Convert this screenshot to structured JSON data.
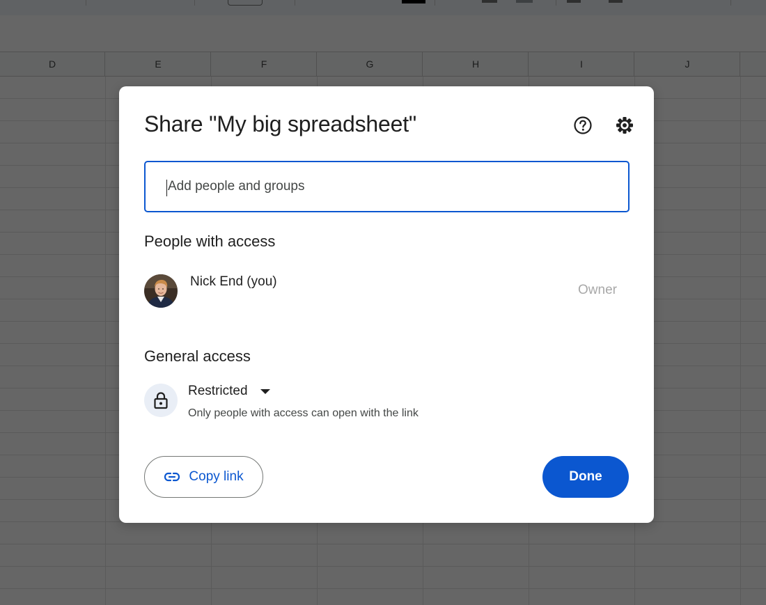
{
  "spreadsheet": {
    "column_headers": [
      "D",
      "E",
      "F",
      "G",
      "H",
      "I",
      "J"
    ]
  },
  "dialog": {
    "title": "Share \"My big spreadsheet\"",
    "help_icon": "help-circle-icon",
    "settings_icon": "gear-icon",
    "add_people": {
      "placeholder": "Add people and groups",
      "value": ""
    },
    "people_heading": "People with access",
    "people": [
      {
        "name": "Nick End (you)",
        "role": "Owner",
        "avatar": "user-avatar"
      }
    ],
    "general_access": {
      "heading": "General access",
      "icon": "lock-icon",
      "level": "Restricted",
      "description": "Only people with access can open with the link"
    },
    "copy_link": {
      "label": "Copy link",
      "icon": "link-icon"
    },
    "done": {
      "label": "Done"
    }
  },
  "colors": {
    "accent": "#0b57d0",
    "text_primary": "#1f1f1f",
    "text_secondary": "#444746",
    "role_muted": "#a8a8a8",
    "lock_circle_bg": "#e9eef6",
    "overlay": "rgba(0,0,0,0.6)"
  }
}
